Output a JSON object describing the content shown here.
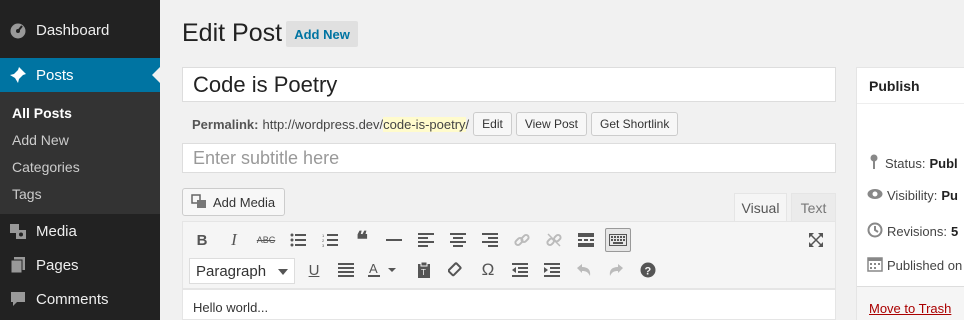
{
  "sidebar": {
    "items": [
      {
        "label": "Dashboard",
        "icon": "dashboard-icon"
      },
      {
        "label": "Posts",
        "icon": "pushpin-icon"
      },
      {
        "label": "Media",
        "icon": "media-icon"
      },
      {
        "label": "Pages",
        "icon": "pages-icon"
      },
      {
        "label": "Comments",
        "icon": "comments-icon"
      }
    ],
    "submenu": [
      "All Posts",
      "Add New",
      "Categories",
      "Tags"
    ],
    "active_color": "#0074a2"
  },
  "header": {
    "title": "Edit Post",
    "add_new_label": "Add New"
  },
  "post": {
    "title": "Code is Poetry",
    "permalink_label": "Permalink:",
    "permalink_base": "http://wordpress.dev/",
    "permalink_slug": "code-is-poetry",
    "permalink_end": "/",
    "permalink_buttons": [
      "Edit",
      "View Post",
      "Get Shortlink"
    ],
    "subtitle_placeholder": "Enter subtitle here"
  },
  "editor": {
    "add_media_label": "Add Media",
    "tabs": [
      "Visual",
      "Text"
    ],
    "format_value": "Paragraph",
    "content": "Hello world..."
  },
  "publish": {
    "title": "Publish",
    "status_label": "Status:",
    "status_value": "Publ",
    "visibility_label": "Visibility:",
    "visibility_value": "Pu",
    "revisions_label": "Revisions:",
    "revisions_value": "5",
    "published_text": "Published on",
    "trash_label": "Move to Trash"
  }
}
